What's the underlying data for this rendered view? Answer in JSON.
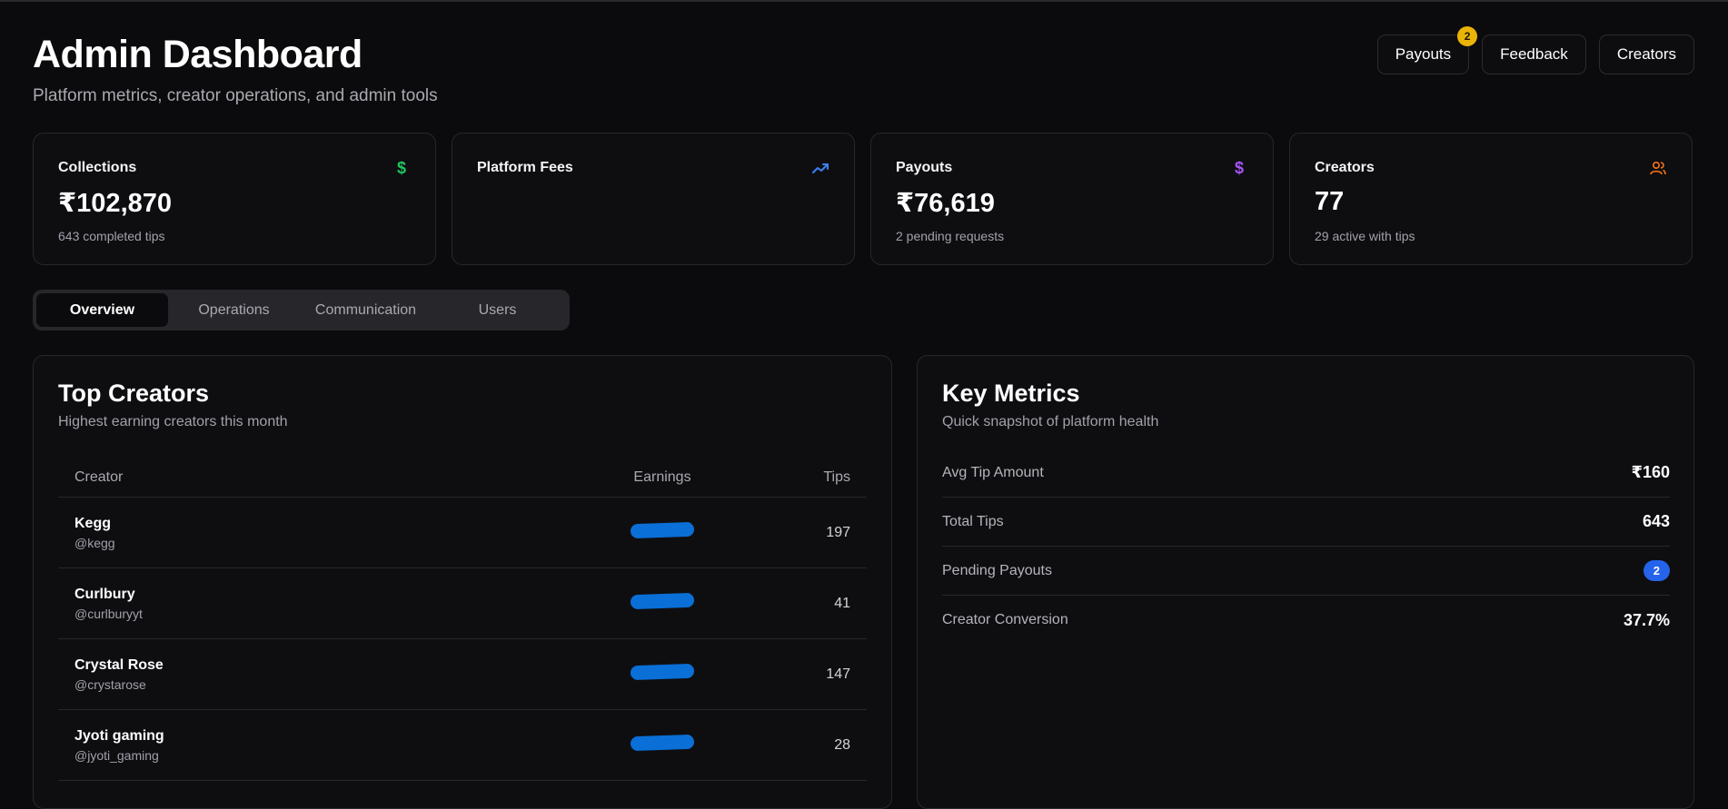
{
  "colors": {
    "background": "#0b0b0d",
    "card": "#0e0e11",
    "border": "#27272c",
    "badge": "#eab308",
    "accent_blue": "#2563eb",
    "icon_green": "#22c55e",
    "icon_blue": "#3b82f6",
    "icon_purple": "#a855f7",
    "icon_orange": "#f97316"
  },
  "header": {
    "title": "Admin Dashboard",
    "subtitle": "Platform metrics, creator operations, and admin tools",
    "buttons": [
      {
        "label": "Payouts",
        "badge": "2"
      },
      {
        "label": "Feedback"
      },
      {
        "label": "Creators"
      }
    ]
  },
  "stats": [
    {
      "label": "Collections",
      "value": "₹102,870",
      "sub": "643 completed tips",
      "icon": "dollar-icon"
    },
    {
      "label": "Platform Fees",
      "value": "",
      "sub": "",
      "icon": "trending-up-icon"
    },
    {
      "label": "Payouts",
      "value": "₹76,619",
      "sub": "2 pending requests",
      "icon": "dollar-icon"
    },
    {
      "label": "Creators",
      "value": "77",
      "sub": "29 active with tips",
      "icon": "users-icon"
    }
  ],
  "tabs": [
    {
      "label": "Overview",
      "active": true
    },
    {
      "label": "Operations"
    },
    {
      "label": "Communication"
    },
    {
      "label": "Users"
    }
  ],
  "top_creators": {
    "title": "Top Creators",
    "subtitle": "Highest earning creators this month",
    "columns": [
      "Creator",
      "Earnings",
      "Tips"
    ],
    "rows": [
      {
        "name": "Kegg",
        "handle": "@kegg",
        "tips": "197"
      },
      {
        "name": "Curlbury",
        "handle": "@curlburyyt",
        "tips": "41"
      },
      {
        "name": "Crystal Rose",
        "handle": "@crystarose",
        "tips": "147"
      },
      {
        "name": "Jyoti gaming",
        "handle": "@jyoti_gaming",
        "tips": "28"
      }
    ]
  },
  "key_metrics": {
    "title": "Key Metrics",
    "subtitle": "Quick snapshot of platform health",
    "rows": [
      {
        "label": "Avg Tip Amount",
        "value": "₹160"
      },
      {
        "label": "Total Tips",
        "value": "643"
      },
      {
        "label": "Pending Payouts",
        "value": "2"
      },
      {
        "label": "Creator Conversion",
        "value": "37.7%"
      }
    ]
  }
}
